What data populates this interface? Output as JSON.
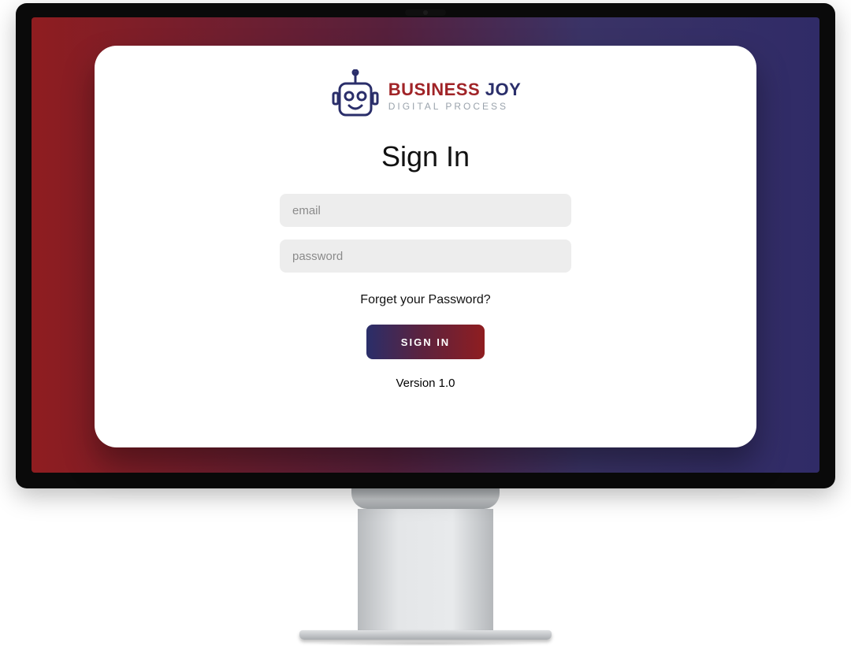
{
  "brand": {
    "main_biz": "BUSINESS ",
    "main_joy": "JOY",
    "sub": "DIGITAL PROCESS"
  },
  "heading": "Sign In",
  "email": {
    "placeholder": "email",
    "value": ""
  },
  "password": {
    "placeholder": "password",
    "value": ""
  },
  "forgot": "Forget your Password?",
  "signin_button": "SIGN IN",
  "version": "Version 1.0",
  "colors": {
    "brand_red": "#8f1d20",
    "brand_navy": "#2a2e6a",
    "input_bg": "#ededed"
  }
}
